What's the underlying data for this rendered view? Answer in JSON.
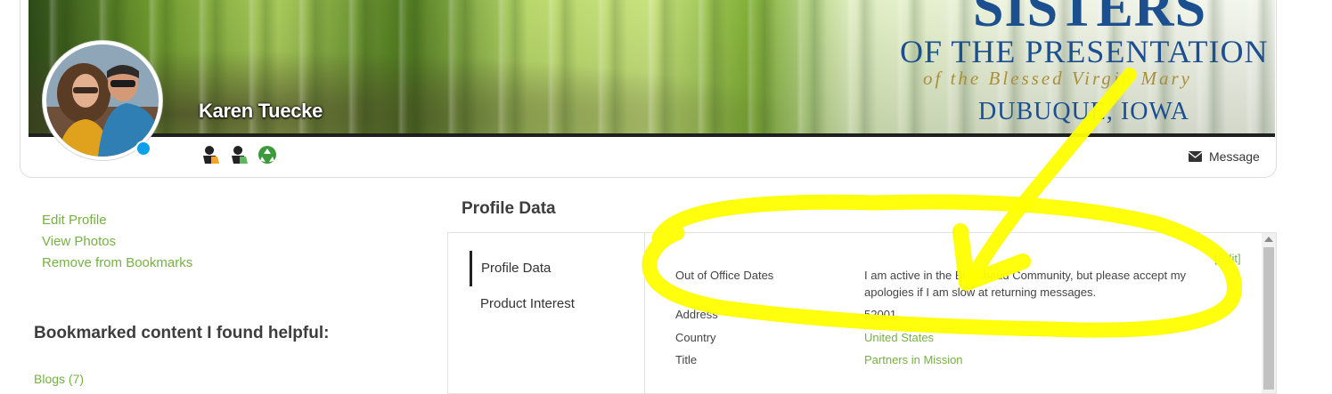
{
  "header": {
    "banner_line1": "SISTERS",
    "banner_line2": "OF THE PRESENTATION",
    "banner_line3": "of the Blessed Virgin Mary",
    "banner_line4": "DUBUQUE, IOWA",
    "profile_name": "Karen Tuecke",
    "status": "online",
    "badges": [
      "person-badge-icon",
      "person-badge-icon",
      "recycle-badge-icon"
    ],
    "message_label": "Message"
  },
  "sidebar": {
    "links": [
      {
        "label": "Edit Profile"
      },
      {
        "label": "View Photos"
      },
      {
        "label": "Remove from Bookmarks"
      }
    ],
    "bookmarks_heading": "Bookmarked content I found helpful:",
    "bookmark_item": "Blogs (7)"
  },
  "main": {
    "section_heading": "Profile Data",
    "tabs": [
      {
        "label": "Profile Data",
        "active": true
      },
      {
        "label": "Product Interest",
        "active": false
      }
    ],
    "edit_label": "[Edit]",
    "fields": [
      {
        "label": "Out of Office Dates",
        "value": "I am active in the Blackbaud Community, but please accept my apologies if I am slow at returning messages."
      },
      {
        "label": "Address",
        "value": "52001"
      },
      {
        "label": "Country",
        "value": "United States"
      },
      {
        "label": "Title",
        "value": "Partners in Mission"
      }
    ]
  },
  "colors": {
    "link_green": "#76b143",
    "status_blue": "#0aa1e8",
    "annotation_yellow": "#ffff00",
    "banner_text_blue": "#1b4f8f"
  }
}
